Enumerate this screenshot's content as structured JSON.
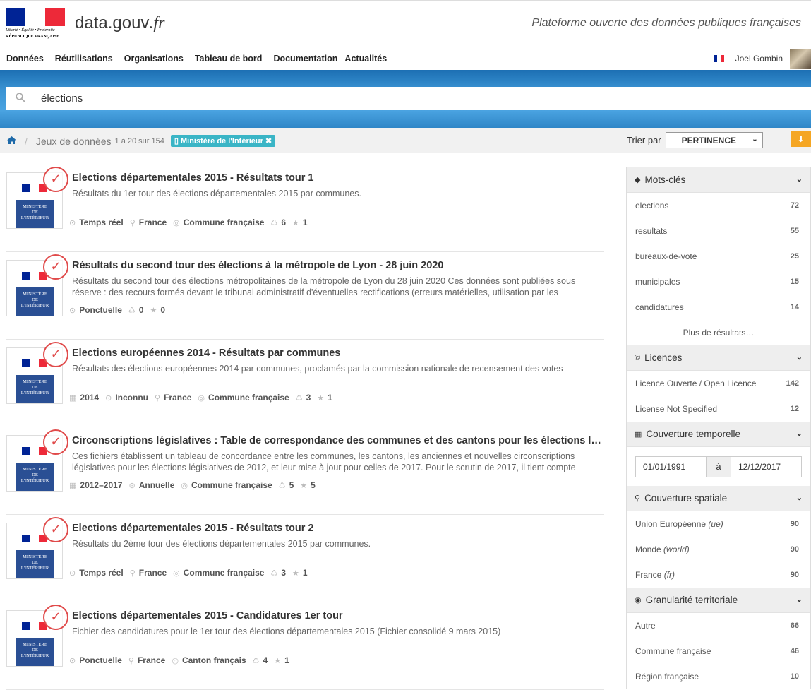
{
  "header": {
    "logo_motto": "Liberté • Égalité • Fraternité",
    "logo_republic": "RÉPUBLIQUE FRANÇAISE",
    "site_name": "data.gouv",
    "site_tld": ".fr",
    "tagline": "Plateforme ouverte des données publiques françaises"
  },
  "nav": {
    "items": [
      "Données",
      "Réutilisations",
      "Organisations",
      "Tableau de bord",
      "Documentation",
      "Actualités"
    ],
    "user_name": "Joel Gombin"
  },
  "search": {
    "value": "élections"
  },
  "breadcrumb": {
    "section": "Jeux de données",
    "count": "1 à 20 sur 154",
    "filter_tag": "Ministère de l'Intérieur",
    "sort_label": "Trier par",
    "sort_value": "PERTINENCE"
  },
  "logo_text": [
    "MINISTÈRE",
    "DE",
    "L'INTÉRIEUR"
  ],
  "results": [
    {
      "title": "Elections départementales 2015 - Résultats tour 1",
      "desc": "Résultats du 1er tour des élections départementales 2015 par communes.",
      "meta": [
        {
          "icon": "clock-icon",
          "text": "Temps réel"
        },
        {
          "icon": "location-icon",
          "text": "France"
        },
        {
          "icon": "target-icon",
          "text": "Commune française"
        },
        {
          "icon": "recycle-icon",
          "text": "6"
        },
        {
          "icon": "star-icon",
          "text": "1"
        }
      ]
    },
    {
      "title": "Résultats du second tour des élections à la métropole de Lyon - 28 juin 2020",
      "desc": "Résultats du second tour des élections métropolitaines de la métropole de Lyon du 28 juin 2020 Ces données sont publiées sous réserve : des recours formés devant le tribunal administratif d'éventuelles rectifications (erreurs matérielles, utilisation par les",
      "meta": [
        {
          "icon": "clock-icon",
          "text": "Ponctuelle"
        },
        {
          "icon": "recycle-icon",
          "text": "0"
        },
        {
          "icon": "star-icon",
          "text": "0"
        }
      ]
    },
    {
      "title": "Elections européennes 2014 - Résultats par communes",
      "desc": "Résultats des élections européennes 2014 par communes, proclamés par la commission nationale de recensement des votes",
      "meta": [
        {
          "icon": "calendar-icon",
          "text": "2014"
        },
        {
          "icon": "clock-icon",
          "text": "Inconnu"
        },
        {
          "icon": "location-icon",
          "text": "France"
        },
        {
          "icon": "target-icon",
          "text": "Commune française"
        },
        {
          "icon": "recycle-icon",
          "text": "3"
        },
        {
          "icon": "star-icon",
          "text": "1"
        }
      ]
    },
    {
      "title": "Circonscriptions législatives : Table de correspondance des communes et des cantons pour les élections législatives",
      "desc": "Ces fichiers établissent un tableau de concordance entre les communes, les cantons, les anciennes et nouvelles circonscriptions législatives pour les élections législatives de 2012, et leur mise à jour pour celles de 2017. Pour le scrutin de 2017, il tient compte",
      "meta": [
        {
          "icon": "calendar-icon",
          "text": "2012–2017"
        },
        {
          "icon": "clock-icon",
          "text": "Annuelle"
        },
        {
          "icon": "target-icon",
          "text": "Commune française"
        },
        {
          "icon": "recycle-icon",
          "text": "5"
        },
        {
          "icon": "star-icon",
          "text": "5"
        }
      ]
    },
    {
      "title": "Elections départementales 2015 - Résultats tour 2",
      "desc": "Résultats du 2ème tour des élections départementales 2015 par communes.",
      "meta": [
        {
          "icon": "clock-icon",
          "text": "Temps réel"
        },
        {
          "icon": "location-icon",
          "text": "France"
        },
        {
          "icon": "target-icon",
          "text": "Commune française"
        },
        {
          "icon": "recycle-icon",
          "text": "3"
        },
        {
          "icon": "star-icon",
          "text": "1"
        }
      ]
    },
    {
      "title": "Elections départementales 2015 - Candidatures 1er tour",
      "desc": "Fichier des candidatures pour le 1er tour des élections départementales 2015 (Fichier consolidé 9 mars 2015)",
      "meta": [
        {
          "icon": "clock-icon",
          "text": "Ponctuelle"
        },
        {
          "icon": "location-icon",
          "text": "France"
        },
        {
          "icon": "target-icon",
          "text": "Canton français"
        },
        {
          "icon": "recycle-icon",
          "text": "4"
        },
        {
          "icon": "star-icon",
          "text": "1"
        }
      ]
    }
  ],
  "facets": {
    "keywords": {
      "title": "Mots-clés",
      "items": [
        {
          "label": "elections",
          "count": "72"
        },
        {
          "label": "resultats",
          "count": "55"
        },
        {
          "label": "bureaux-de-vote",
          "count": "25"
        },
        {
          "label": "municipales",
          "count": "15"
        },
        {
          "label": "candidatures",
          "count": "14"
        }
      ],
      "more": "Plus de résultats…"
    },
    "licences": {
      "title": "Licences",
      "items": [
        {
          "label": "Licence Ouverte / Open Licence",
          "count": "142"
        },
        {
          "label": "License Not Specified",
          "count": "12"
        }
      ]
    },
    "temporal": {
      "title": "Couverture temporelle",
      "from": "01/01/1991",
      "to_label": "à",
      "to": "12/12/2017"
    },
    "spatial": {
      "title": "Couverture spatiale",
      "items": [
        {
          "label": "Union Européenne",
          "code": "(ue)",
          "count": "90"
        },
        {
          "label": "Monde",
          "code": "(world)",
          "count": "90"
        },
        {
          "label": "France",
          "code": "(fr)",
          "count": "90"
        }
      ]
    },
    "granularity": {
      "title": "Granularité territoriale",
      "items": [
        {
          "label": "Autre",
          "count": "66"
        },
        {
          "label": "Commune française",
          "count": "46"
        },
        {
          "label": "Région française",
          "count": "10"
        }
      ]
    }
  },
  "colors": {
    "blue": "#1e6aa9",
    "tag": "#3ab5c6",
    "download": "#f5a623",
    "flag_blue": "#002395",
    "flag_red": "#ed2939"
  }
}
